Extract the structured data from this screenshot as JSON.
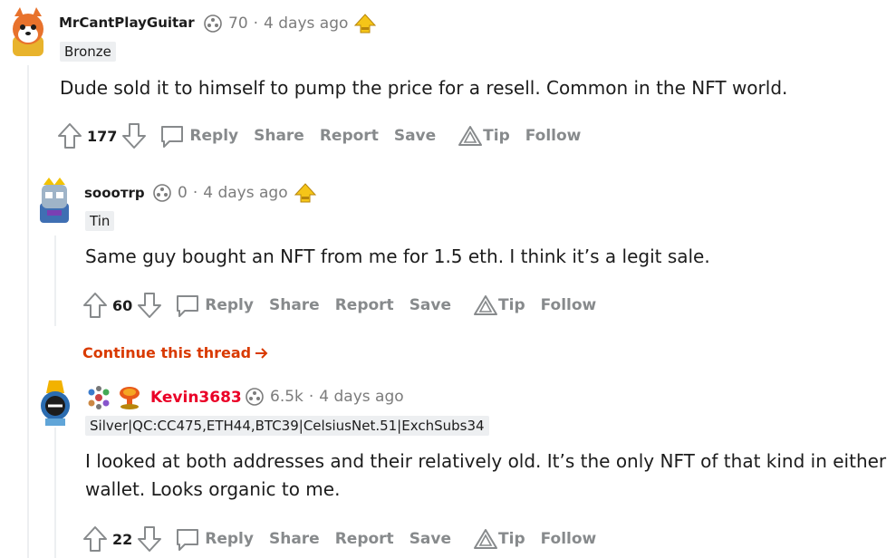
{
  "comments": [
    {
      "username": "MrCantPlayGuitar",
      "karma": "70",
      "age": "4 days ago",
      "flair": "Bronze",
      "body": "Dude sold it to himself to pump the price for a resell. Common in the NFT world.",
      "votes": "177"
    },
    {
      "username": "sooотrp",
      "karma": "0",
      "age": "4 days ago",
      "flair": "Tin",
      "body": "Same guy bought an NFT from me for 1.5 eth. I think it’s a legit sale.",
      "votes": "60"
    },
    {
      "username": "Kevin3683",
      "karma": "6.5k",
      "age": "4 days ago",
      "flair": "Silver|QC:CC475,ETH44,BTC39|CelsiusNet.51|ExchSubs34",
      "body_line1": "I looked at both addresses and their relatively old. It’s the only NFT of that kind in either",
      "body_line2": "wallet. Looks organic to me.",
      "votes": "22"
    }
  ],
  "actions": {
    "reply": "Reply",
    "share": "Share",
    "report": "Report",
    "save": "Save",
    "tip": "Tip",
    "follow": "Follow"
  },
  "continue_thread": "Continue this thread",
  "separator": "·",
  "colors": {
    "accent_orange": "#d93a00",
    "name_red": "#ea0027",
    "muted": "#878a8c"
  }
}
